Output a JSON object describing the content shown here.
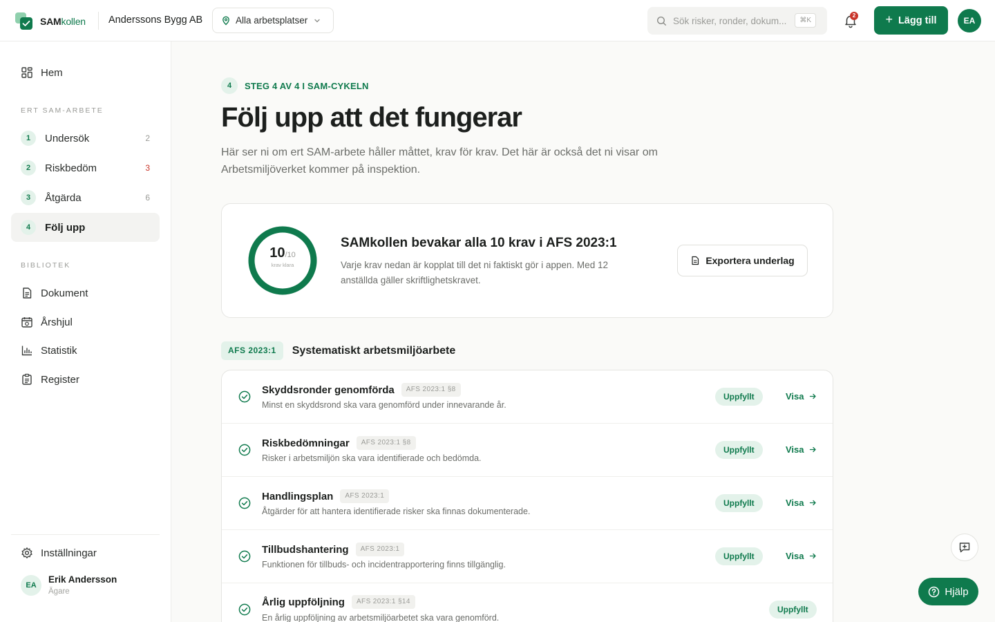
{
  "app": {
    "brand_main": "SAM",
    "brand_accent": "kollen",
    "company": "Anderssons Bygg AB",
    "workplace_selected": "Alla arbetsplatser",
    "search_placeholder": "Sök risker, ronder, dokum...",
    "search_shortcut": "⌘K",
    "notifications_count": "2",
    "add_label": "Lägg till",
    "user_initials": "EA",
    "accent_color": "#0f7a4d",
    "alert_color": "#c9352a"
  },
  "sidebar": {
    "home": "Hem",
    "section_sam": "ERT SAM-ARBETE",
    "steps": [
      {
        "num": "1",
        "label": "Undersök",
        "count": "2"
      },
      {
        "num": "2",
        "label": "Riskbedöm",
        "count": "3"
      },
      {
        "num": "3",
        "label": "Åtgärda",
        "count": "6"
      },
      {
        "num": "4",
        "label": "Följ upp",
        "count": ""
      }
    ],
    "section_library": "BIBLIOTEK",
    "library": [
      {
        "label": "Dokument",
        "icon": "document-icon"
      },
      {
        "label": "Årshjul",
        "icon": "calendar-icon"
      },
      {
        "label": "Statistik",
        "icon": "bar-chart-icon"
      },
      {
        "label": "Register",
        "icon": "clipboard-icon"
      }
    ],
    "settings": "Inställningar",
    "user": {
      "initials": "EA",
      "name": "Erik Andersson",
      "role": "Ägare"
    }
  },
  "main": {
    "step_num": "4",
    "step_caption": "STEG 4 AV 4 I SAM-CYKELN",
    "title": "Följ upp att det fungerar",
    "description": "Här ser ni om ert SAM-arbete håller måttet, krav för krav. Det här är också det ni visar om Arbetsmiljöverket kommer på inspektion.",
    "summary": {
      "done": "10",
      "total": "/10",
      "ring_sub": "krav klara",
      "progress": 1.0,
      "title": "SAMkollen bevakar alla 10 krav i AFS 2023:1",
      "text": "Varje krav nedan är kopplat till det ni faktiskt gör i appen. Med 12 anställda gäller skriftlighetskravet.",
      "export_label": "Exportera underlag"
    },
    "section": {
      "pill": "AFS 2023:1",
      "title": "Systematiskt arbetsmiljöarbete"
    },
    "requirements": [
      {
        "name": "Skyddsronder genomförda",
        "ref": "AFS 2023:1 §8",
        "desc": "Minst en skyddsrond ska vara genomförd under innevarande år.",
        "status": "Uppfyllt",
        "link": "Visa"
      },
      {
        "name": "Riskbedömningar",
        "ref": "AFS 2023:1 §8",
        "desc": "Risker i arbetsmiljön ska vara identifierade och bedömda.",
        "status": "Uppfyllt",
        "link": "Visa"
      },
      {
        "name": "Handlingsplan",
        "ref": "AFS 2023:1",
        "desc": "Åtgärder för att hantera identifierade risker ska finnas dokumenterade.",
        "status": "Uppfyllt",
        "link": "Visa"
      },
      {
        "name": "Tillbudshantering",
        "ref": "AFS 2023:1",
        "desc": "Funktionen för tillbuds- och incidentrapportering finns tillgänglig.",
        "status": "Uppfyllt",
        "link": "Visa"
      },
      {
        "name": "Årlig uppföljning",
        "ref": "AFS 2023:1 §14",
        "desc": "En årlig uppföljning av arbetsmiljöarbetet ska vara genomförd.",
        "status": "Uppfyllt",
        "link": ""
      }
    ]
  },
  "help_label": "Hjälp"
}
